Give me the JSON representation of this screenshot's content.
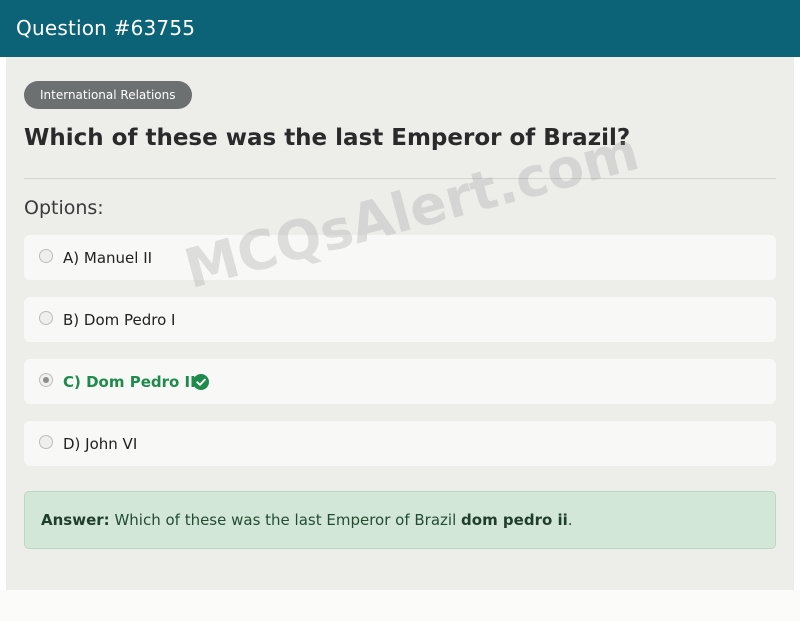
{
  "header": {
    "title": "Question #63755"
  },
  "badge": {
    "label": "International Relations"
  },
  "question": {
    "text": "Which of these was the last Emperor of Brazil?"
  },
  "options_label": "Options:",
  "options": [
    {
      "label": "A) Manuel II",
      "selected": false,
      "correct": false
    },
    {
      "label": "B) Dom Pedro I",
      "selected": false,
      "correct": false
    },
    {
      "label": "C) Dom Pedro II",
      "selected": true,
      "correct": true
    },
    {
      "label": "D) John VI",
      "selected": false,
      "correct": false
    }
  ],
  "answer": {
    "label": "Answer:",
    "text": "Which of these was the last Emperor of Brazil",
    "value": "dom pedro ii",
    "suffix": "."
  },
  "watermark": "MCQsAlert.com",
  "colors": {
    "header": "#0c6378",
    "correct": "#1e8a4c",
    "answer_bg": "#d3e7d8"
  }
}
